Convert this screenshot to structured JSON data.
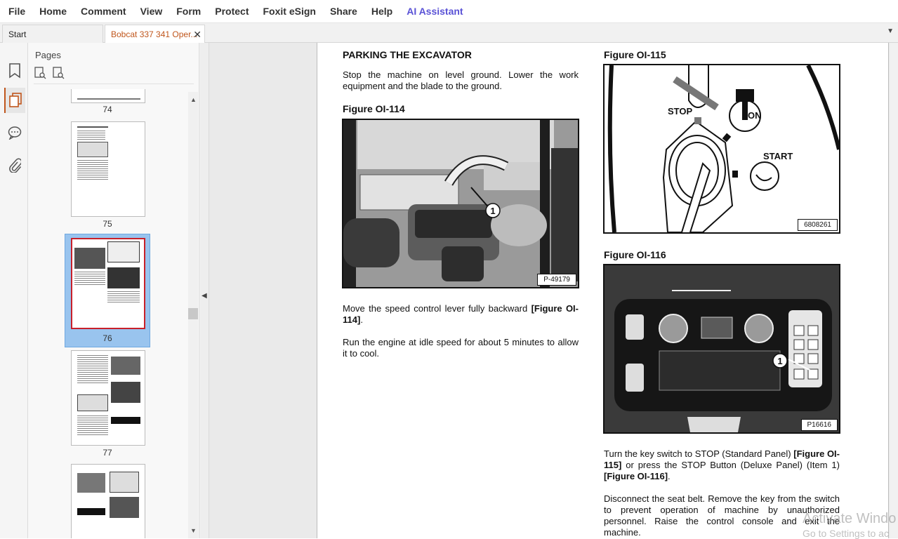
{
  "menu": [
    "File",
    "Home",
    "Comment",
    "View",
    "Form",
    "Protect",
    "Foxit eSign",
    "Share",
    "Help",
    "AI Assistant"
  ],
  "tabs": {
    "start": "Start",
    "doc": "Bobcat 337 341 Oper..."
  },
  "panel": {
    "title": "Pages",
    "pages": [
      "74",
      "75",
      "76",
      "77"
    ]
  },
  "content": {
    "left_heading": "PARKING THE EXCAVATOR",
    "para1": "Stop the machine on level ground. Lower the work equipment and the blade to the ground.",
    "fig114_title": "Figure OI-114",
    "fig114_code": "P-49179",
    "para2_text": "Move the speed control lever fully backward ",
    "para2_ref": "[Figure OI-114]",
    "para3": "Run the engine at idle speed for about 5 minutes to allow it to cool.",
    "fig115_title": "Figure OI-115",
    "fig115_code": "6808261",
    "fig115_stop": "STOP",
    "fig115_on": "ON",
    "fig115_start": "START",
    "fig116_title": "Figure OI-116",
    "fig116_code": "P16616",
    "callout": "1",
    "para4_a": "Turn the key switch to STOP (Standard Panel) ",
    "para4_ref1": "[Figure OI-115]",
    "para4_b": " or press the STOP Button (Deluxe Panel) (Item 1) ",
    "para4_ref2": "[Figure OI-116]",
    "para5": "Disconnect the seat belt. Remove the key from the switch to prevent operation of machine by unauthorized personnel. Raise the control console and exit the machine."
  },
  "watermark": {
    "line1": "Activate Windo",
    "line2": "Go to Settings to ac"
  }
}
